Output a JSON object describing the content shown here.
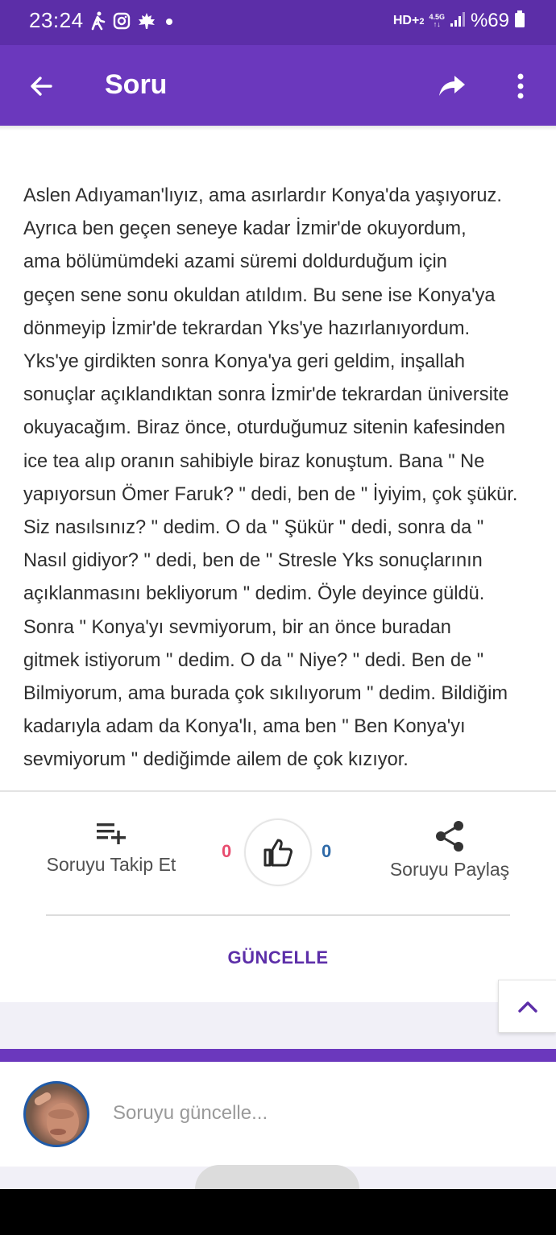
{
  "status_bar": {
    "time": "23:24",
    "network": "HD+",
    "network_sub": "2",
    "network_gen": "4.5G",
    "battery": "%69",
    "icons": [
      "walk-icon",
      "instagram-icon",
      "maple-leaf-icon",
      "dot-icon",
      "signal-icon",
      "battery-icon"
    ]
  },
  "app_bar": {
    "title": "Soru",
    "back_icon": "back-arrow-icon",
    "share_icon": "share-arrow-icon",
    "menu_icon": "more-vertical-icon",
    "background": "#6b38bd"
  },
  "question": {
    "lines": [
      "Aslen Adıyaman'lıyız, ama asırlardır Konya'da yaşıyoruz.",
      "Ayrıca ben geçen seneye kadar İzmir'de okuyordum,",
      "ama bölümümdeki azami süremi doldurduğum için",
      "geçen sene sonu okuldan atıldım. Bu sene ise Konya'ya",
      "dönmeyip İzmir'de tekrardan Yks'ye hazırlanıyordum.",
      "Yks'ye girdikten sonra Konya'ya geri geldim, inşallah",
      "sonuçlar açıklandıktan sonra İzmir'de tekrardan üniversite",
      "okuyacağım. Biraz önce, oturduğumuz sitenin kafesinden",
      "ice tea alıp oranın sahibiyle biraz konuştum. Bana \" Ne",
      "yapıyorsun Ömer Faruk? \" dedi, ben de \" İyiyim, çok şükür.",
      "Siz nasılsınız? \" dedim. O da \" Şükür \" dedi, sonra da \"",
      "Nasıl gidiyor? \" dedi, ben de \" Stresle Yks sonuçlarının",
      "açıklanmasını bekliyorum \" dedim. Öyle deyince güldü.",
      "Sonra \" Konya'yı sevmiyorum, bir an önce buradan",
      "gitmek istiyorum \" dedim. O da \" Niye? \" dedi. Ben de \"",
      "Bilmiyorum, ama burada çok sıkılıyorum \" dedim. Bildiğim",
      "kadarıyla adam da Konya'lı, ama ben \" Ben Konya'yı",
      "sevmiyorum \" dediğimde ailem de çok kızıyor."
    ]
  },
  "actions": {
    "follow_label": "Soruyu Takip Et",
    "follow_icon": "playlist-add-icon",
    "dislike_count": "0",
    "like_count": "0",
    "like_icon": "thumbs-up-icon",
    "share_label": "Soruyu Paylaş",
    "share_icon": "share-nodes-icon",
    "count_left_color": "#e84d6f",
    "count_right_color": "#2f6aa8"
  },
  "update_label": "GÜNCELLE",
  "scroll_top_icon": "chevron-up-icon",
  "composer": {
    "placeholder": "Soruyu güncelle...",
    "avatar": "user-avatar"
  }
}
